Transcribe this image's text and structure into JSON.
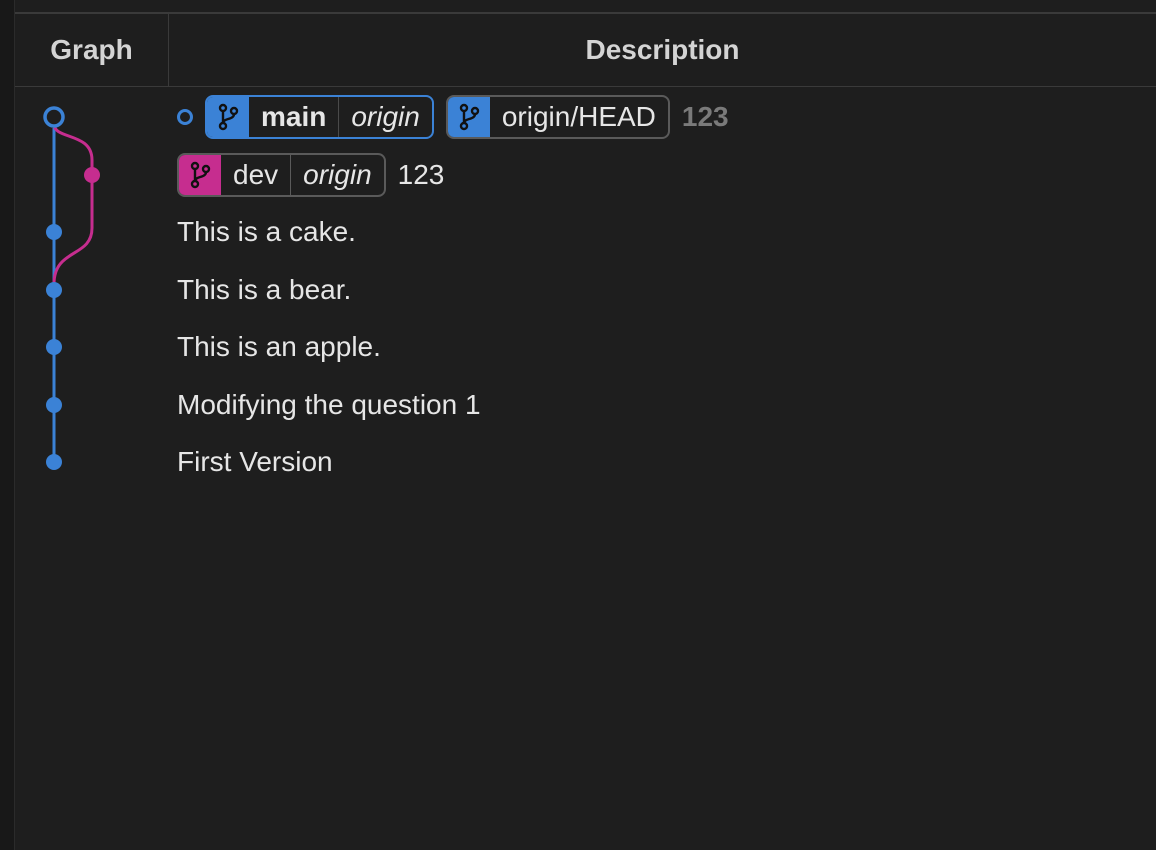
{
  "header": {
    "graph_label": "Graph",
    "description_label": "Description"
  },
  "colors": {
    "main_branch": "#3b82d6",
    "dev_branch": "#c62d8f",
    "background": "#1e1e1e"
  },
  "commits": [
    {
      "refs": [
        {
          "type": "branch",
          "name": "main",
          "remote": "origin",
          "icon": "git-branch-icon",
          "color": "#3b82d6"
        },
        {
          "type": "remote-head",
          "name": "origin/HEAD",
          "icon": "git-branch-icon",
          "color": "#3b82d6"
        }
      ],
      "message": "123",
      "lane": "main",
      "node": "ring"
    },
    {
      "refs": [
        {
          "type": "branch",
          "name": "dev",
          "remote": "origin",
          "icon": "git-branch-icon",
          "color": "#c62d8f"
        }
      ],
      "message": "123",
      "lane": "dev",
      "node": "dot"
    },
    {
      "message": "This is a cake.",
      "lane": "main",
      "node": "dot"
    },
    {
      "message": "This is a bear.",
      "lane": "main",
      "node": "dot"
    },
    {
      "message": "This is an apple.",
      "lane": "main",
      "node": "dot"
    },
    {
      "message": "Modifying the question 1",
      "lane": "main",
      "node": "dot"
    },
    {
      "message": "First Version",
      "lane": "main",
      "node": "dot"
    }
  ]
}
